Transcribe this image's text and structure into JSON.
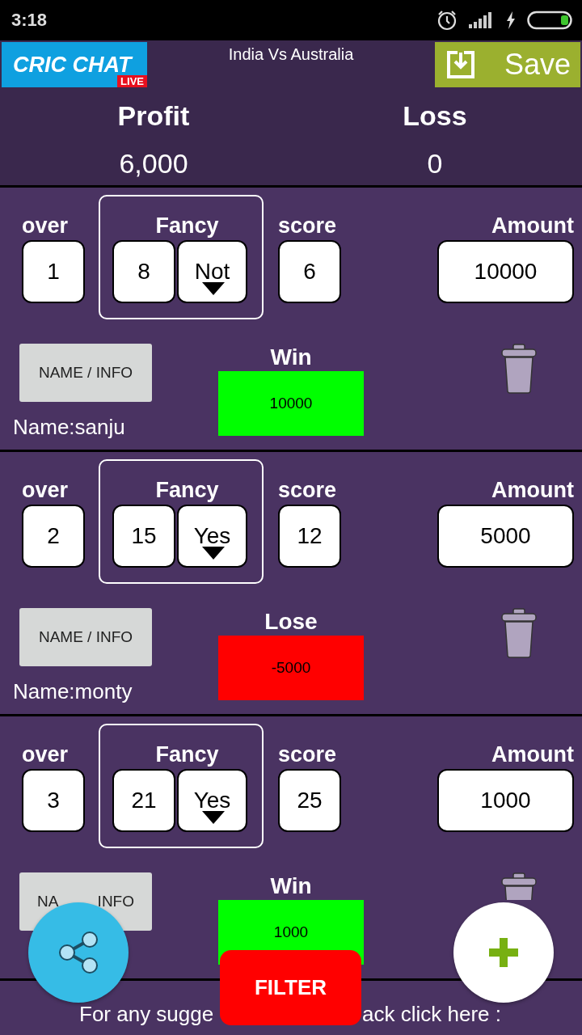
{
  "status_bar": {
    "time": "3:18"
  },
  "header": {
    "logo": {
      "name": "CRIC CHAT",
      "badge": "LIVE"
    },
    "title": "India Vs Australia",
    "save_button": "Save"
  },
  "summary": [
    {
      "label": "Profit",
      "value": "6,000"
    },
    {
      "label": "Loss",
      "value": "0"
    }
  ],
  "entries": [
    {
      "over_label": "over",
      "over": "1",
      "fancy_label": "Fancy",
      "fancy": "8",
      "choice": "Not",
      "score_label": "score",
      "score": "6",
      "amount_label": "Amount",
      "amount": "10000",
      "name_button": [
        "NAME / INFO"
      ],
      "result": {
        "kind": "win",
        "label": "Win",
        "value": "10000"
      },
      "name": "Name:sanju"
    },
    {
      "over_label": "over",
      "over": "2",
      "fancy_label": "Fancy",
      "fancy": "15",
      "choice": "Yes",
      "score_label": "score",
      "score": "12",
      "amount_label": "Amount",
      "amount": "5000",
      "name_button": [
        "NAME / INFO"
      ],
      "result": {
        "kind": "lose",
        "label": "Lose",
        "value": "-5000"
      },
      "name": "Name:monty"
    },
    {
      "over_label": "over",
      "over": "3",
      "fancy_label": "Fancy",
      "fancy": "21",
      "choice": "Yes",
      "score_label": "score",
      "score": "25",
      "amount_label": "Amount",
      "amount": "1000",
      "name_button": [
        "NA",
        "INFO"
      ],
      "result": {
        "kind": "win",
        "label": "Win",
        "value": "1000"
      }
    }
  ],
  "footer": {
    "text_parts": [
      "For any sugge",
      "ack click here :"
    ]
  },
  "filter_button": "FILTER"
}
